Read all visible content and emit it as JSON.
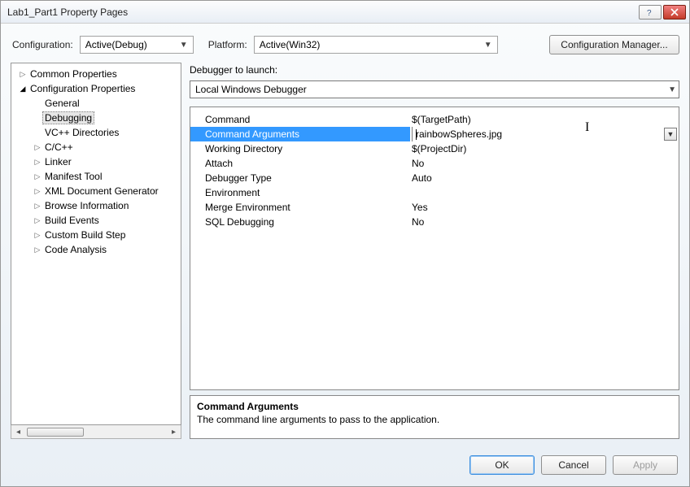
{
  "window": {
    "title": "Lab1_Part1 Property Pages"
  },
  "config_bar": {
    "config_label": "Configuration:",
    "config_value": "Active(Debug)",
    "platform_label": "Platform:",
    "platform_value": "Active(Win32)",
    "manager_button": "Configuration Manager..."
  },
  "tree": {
    "root1": "Common Properties",
    "root2": "Configuration Properties",
    "items": [
      "General",
      "Debugging",
      "VC++ Directories",
      "C/C++",
      "Linker",
      "Manifest Tool",
      "XML Document Generator",
      "Browse Information",
      "Build Events",
      "Custom Build Step",
      "Code Analysis"
    ]
  },
  "debugger": {
    "label": "Debugger to launch:",
    "value": "Local Windows Debugger"
  },
  "grid": {
    "rows": [
      {
        "k": "Command",
        "v": "$(TargetPath)"
      },
      {
        "k": "Command Arguments",
        "v": "rainbowSpheres.jpg"
      },
      {
        "k": "Working Directory",
        "v": "$(ProjectDir)"
      },
      {
        "k": "Attach",
        "v": "No"
      },
      {
        "k": "Debugger Type",
        "v": "Auto"
      },
      {
        "k": "Environment",
        "v": ""
      },
      {
        "k": "Merge Environment",
        "v": "Yes"
      },
      {
        "k": "SQL Debugging",
        "v": "No"
      }
    ]
  },
  "desc": {
    "title": "Command Arguments",
    "text": "The command line arguments to pass to the application."
  },
  "footer": {
    "ok": "OK",
    "cancel": "Cancel",
    "apply": "Apply"
  }
}
